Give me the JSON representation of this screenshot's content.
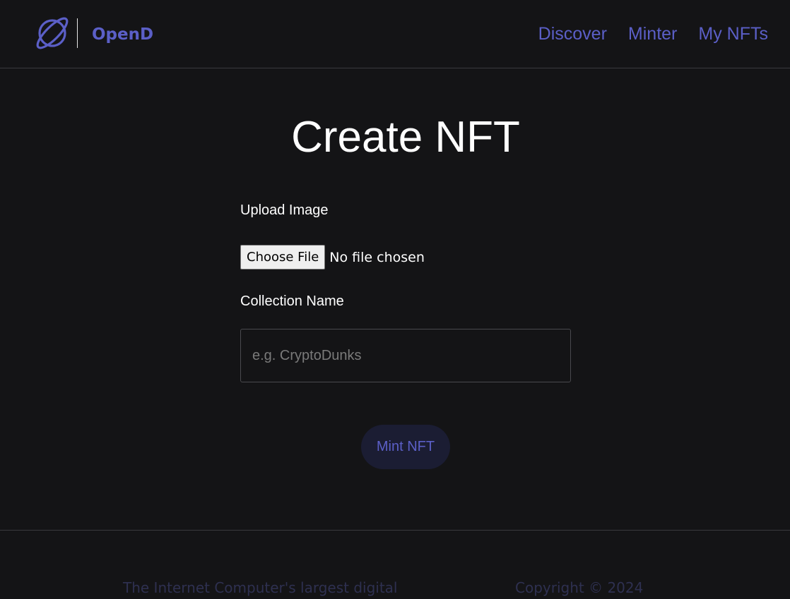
{
  "brand": {
    "name": "OpenD",
    "logo_icon": "planet-icon",
    "color": "#5b5fc7"
  },
  "nav": {
    "items": [
      {
        "label": "Discover"
      },
      {
        "label": "Minter"
      },
      {
        "label": "My NFTs"
      }
    ]
  },
  "main": {
    "title": "Create NFT",
    "upload_label": "Upload Image",
    "file_button_label": "Choose File",
    "file_status": "No file chosen",
    "collection_label": "Collection Name",
    "collection_placeholder": "e.g. CryptoDunks",
    "collection_value": "",
    "mint_button_label": "Mint NFT"
  },
  "footer": {
    "tagline": "The Internet Computer's largest digital",
    "copyright": "Copyright © 2024"
  },
  "colors": {
    "background": "#141416",
    "accent": "#5b5fc7",
    "button_bg": "#1b1d33",
    "footer_text": "#2e3050"
  }
}
